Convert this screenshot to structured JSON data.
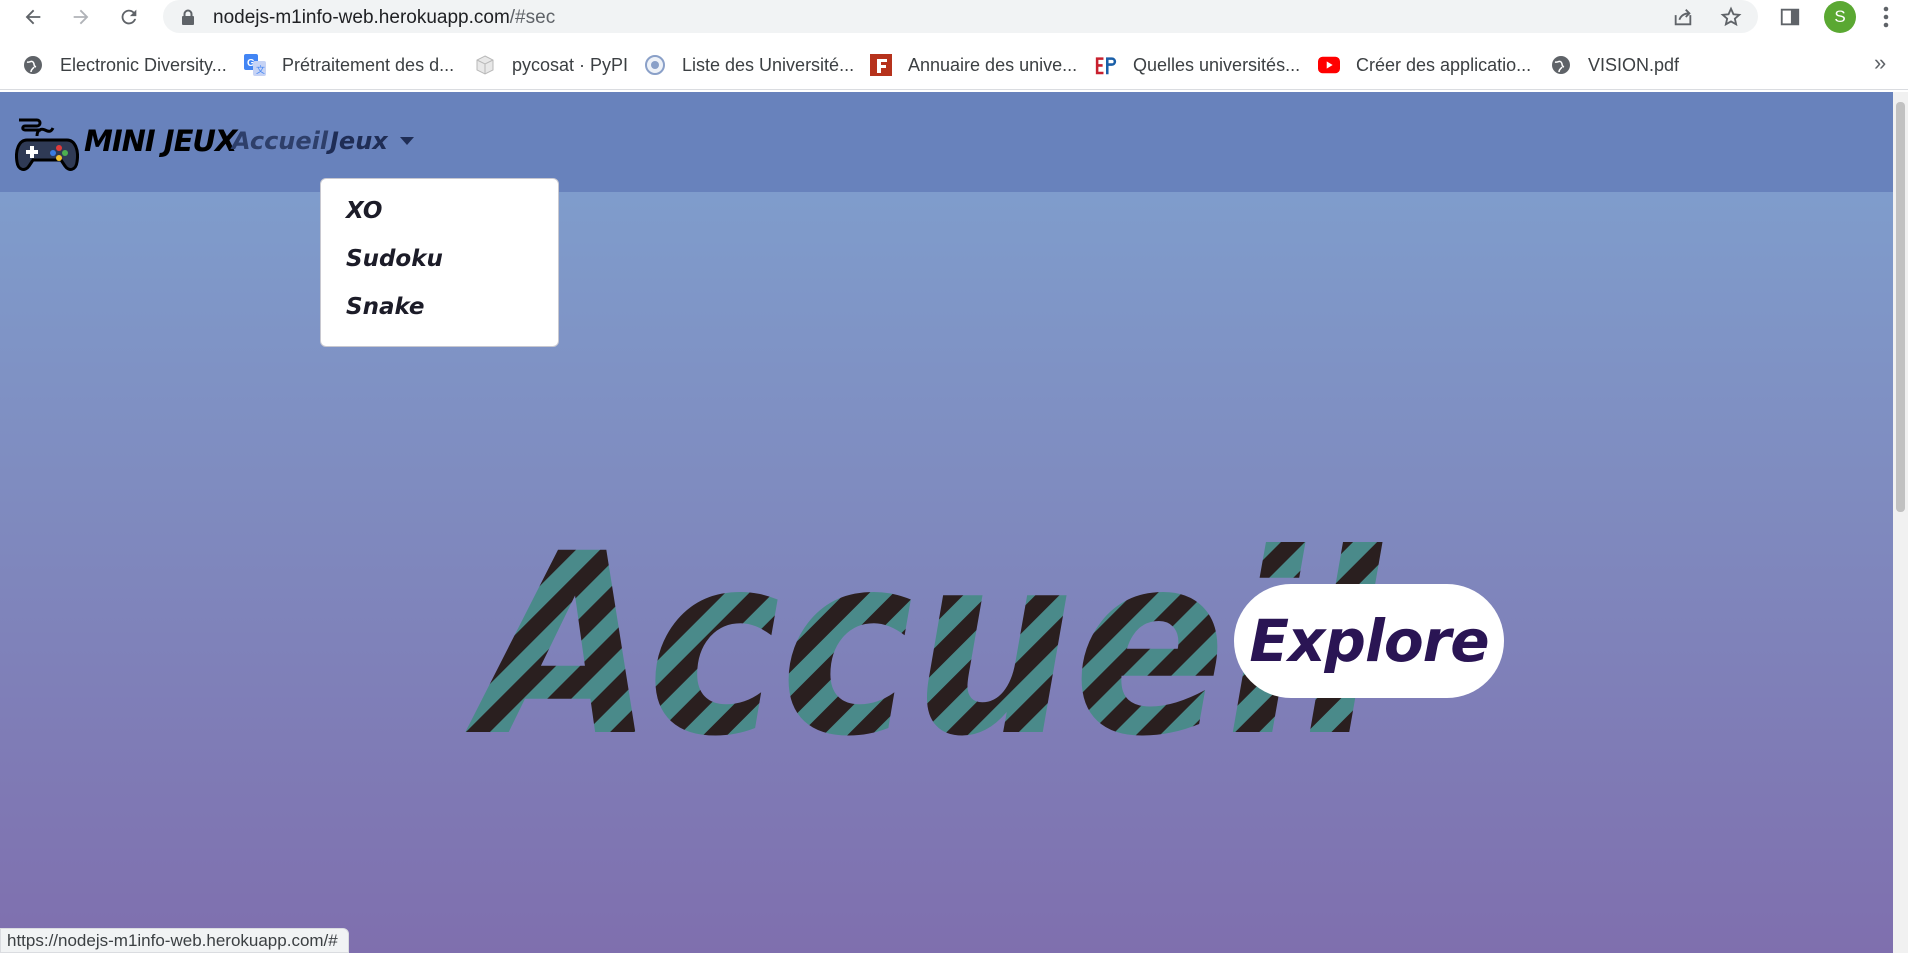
{
  "browser": {
    "url_host": "nodejs-m1info-web.herokuapp.com",
    "url_path": "/#sec",
    "avatar_letter": "S",
    "bookmarks": [
      {
        "label": "Electronic Diversity...",
        "icon": "globe-icon"
      },
      {
        "label": "Prétraitement des d...",
        "icon": "google-translate-icon"
      },
      {
        "label": "pycosat · PyPI",
        "icon": "pypi-cube-icon"
      },
      {
        "label": "Liste des Université...",
        "icon": "seal-icon"
      },
      {
        "label": "Annuaire des unive...",
        "icon": "f-logo-icon"
      },
      {
        "label": "Quelles universités...",
        "icon": "ep-logo-icon"
      },
      {
        "label": "Créer des applicatio...",
        "icon": "youtube-icon"
      },
      {
        "label": "VISION.pdf",
        "icon": "globe-icon"
      }
    ],
    "bookmarks_more": "»",
    "status_url": "https://nodejs-m1info-web.herokuapp.com/#"
  },
  "navbar": {
    "brand": "MINI JEUX",
    "links": {
      "accueil": "Accueil",
      "jeux": "Jeux"
    }
  },
  "dropdown": {
    "items": [
      "XO",
      "Sudoku",
      "Snake"
    ]
  },
  "hero": {
    "title": "Accueil",
    "button": "Explore"
  },
  "colors": {
    "navbar": "#6882bc",
    "stripe_a": "#2a1f1f",
    "stripe_b": "#4a8a8a",
    "button_text": "#2a1554"
  }
}
